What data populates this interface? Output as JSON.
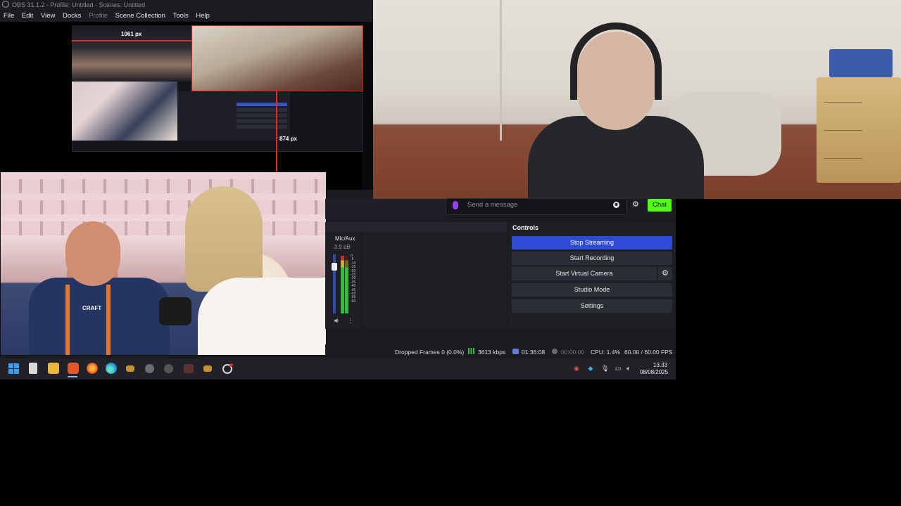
{
  "window": {
    "title": "OBS 31.1.2 - Profile: Untitled - Scenes: Untitled"
  },
  "menu": {
    "file": "File",
    "edit": "Edit",
    "view": "View",
    "docks": "Docks",
    "profile": "Profile",
    "scene_collection": "Scene Collection",
    "tools": "Tools",
    "help": "Help"
  },
  "preview": {
    "width_label": "1061 px",
    "height_label": "874 px"
  },
  "interview": {
    "shirt_text": "CRAFT"
  },
  "chat": {
    "placeholder": "Send a message",
    "send_label": "Chat"
  },
  "mixer": {
    "source_name": "Mic/Aux",
    "level": "-3.9 dB",
    "scale": [
      "0",
      "-5",
      "-10",
      "-15",
      "-20",
      "-25",
      "-30",
      "-35",
      "-40",
      "-45",
      "-50",
      "-55",
      "-60"
    ]
  },
  "controls": {
    "title": "Controls",
    "stop_streaming": "Stop Streaming",
    "start_recording": "Start Recording",
    "start_virtual_camera": "Start Virtual Camera",
    "studio_mode": "Studio Mode",
    "settings": "Settings"
  },
  "status": {
    "dropped_frames": "Dropped Frames 0 (0.0%)",
    "bitrate": "3613 kbps",
    "stream_time": "01:36:08",
    "rec_time": "00:00:00",
    "cpu": "CPU: 1.4%",
    "fps": "60.00 / 60.00 FPS"
  },
  "taskbar": {
    "time": "13.33",
    "date": "08/08/2025"
  },
  "colors": {
    "accent_blue": "#2e4bd6",
    "chat_green": "#53fc18",
    "bg_dark": "#1b1c22"
  }
}
